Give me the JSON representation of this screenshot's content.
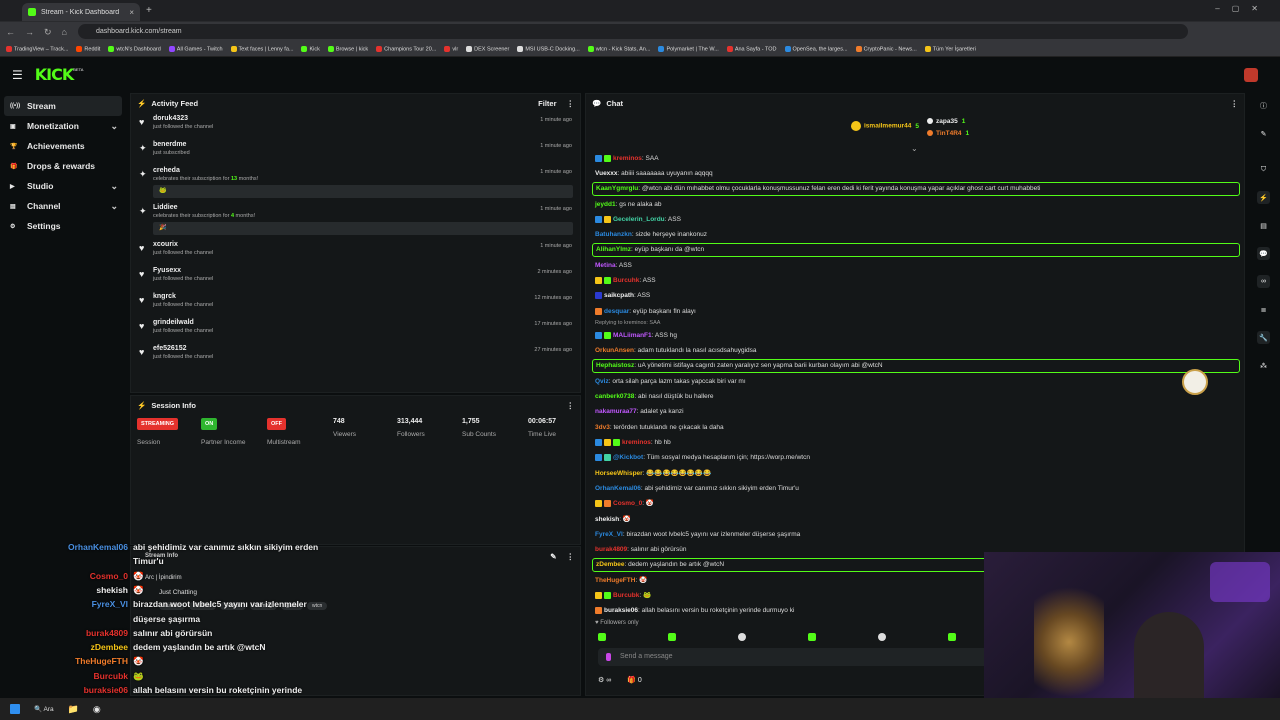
{
  "browser": {
    "tab_title": "Stream - Kick Dashboard",
    "url": "dashboard.kick.com/stream",
    "bookmarks": [
      "TradingView – Track...",
      "Reddit",
      "wtcN's Dashboard",
      "All Games - Twitch",
      "Text faces | Lenny fa...",
      "Kick",
      "Browse | kick",
      "Champions Tour 20...",
      "vlr",
      "DEX Screener",
      "MSI USB-C Docking...",
      "wtcn - Kick Stats, An...",
      "Polymarket | The W...",
      "Ana Sayfa - TOD",
      "OpenSea, the larges...",
      "CryptoPanic - News...",
      "Tüm Yer İşaretleri"
    ]
  },
  "header": {
    "logo": "KICK",
    "logo_tag": "BETA"
  },
  "sidebar": {
    "items": [
      {
        "label": "Stream",
        "icon": "stream-icon",
        "active": true
      },
      {
        "label": "Monetization",
        "icon": "dollar-icon",
        "chevron": true
      },
      {
        "label": "Achievements",
        "icon": "trophy-icon"
      },
      {
        "label": "Drops & rewards",
        "icon": "gift-icon"
      },
      {
        "label": "Studio",
        "icon": "studio-icon",
        "chevron": true
      },
      {
        "label": "Channel",
        "icon": "channel-icon",
        "chevron": true
      },
      {
        "label": "Settings",
        "icon": "gear-icon"
      }
    ]
  },
  "activity": {
    "title": "Activity Feed",
    "filter": "Filter",
    "items": [
      {
        "name": "doruk4323",
        "sub": "just followed the channel",
        "time": "1 minute ago",
        "icon": "heart-icon"
      },
      {
        "name": "benerdme",
        "sub": "just subscribed",
        "time": "1 minute ago",
        "icon": "star-icon"
      },
      {
        "name": "creheda",
        "sub_pre": "celebrates their subscription for ",
        "months": "13",
        "sub_post": " months!",
        "time": "1 minute ago",
        "icon": "star-icon",
        "msg": "🐸"
      },
      {
        "name": "Liddiee",
        "sub_pre": "celebrates their subscription for ",
        "months": "4",
        "sub_post": " months!",
        "time": "1 minute ago",
        "icon": "star-icon",
        "msg": "🎉"
      },
      {
        "name": "xcourix",
        "sub": "just followed the channel",
        "time": "1 minute ago",
        "icon": "heart-icon"
      },
      {
        "name": "Fyusexx",
        "sub": "just followed the channel",
        "time": "2 minutes ago",
        "icon": "heart-icon"
      },
      {
        "name": "kngrck",
        "sub": "just followed the channel",
        "time": "12 minutes ago",
        "icon": "heart-icon"
      },
      {
        "name": "grindeilwald",
        "sub": "just followed the channel",
        "time": "17 minutes ago",
        "icon": "heart-icon"
      },
      {
        "name": "efe526152",
        "sub": "just followed the channel",
        "time": "27 minutes ago",
        "icon": "heart-icon"
      }
    ]
  },
  "session": {
    "title": "Session Info",
    "cells": [
      {
        "badge": "STREAMING",
        "badge_color": "#e5322d",
        "label": "Session"
      },
      {
        "badge": "ON",
        "badge_color": "#2fb52f",
        "label": "Partner Income"
      },
      {
        "badge": "OFF",
        "badge_color": "#e5322d",
        "label": "Multistream"
      },
      {
        "value": "748",
        "label": "Viewers"
      },
      {
        "value": "313,444",
        "label": "Followers"
      },
      {
        "value": "1,755",
        "label": "Sub Counts"
      },
      {
        "value": "00:06:57",
        "label": "Time Live"
      }
    ]
  },
  "stream_info": {
    "title": "Stream Info",
    "title_text": "Arc | İpindirim",
    "category": "Just Chatting",
    "tags": [
      "Turkish",
      "Ranked",
      "Turkce",
      "Gaming",
      "guzel",
      "wtcn"
    ]
  },
  "chat": {
    "title": "Chat",
    "gifters": [
      {
        "name": "ismailmemur44",
        "count": "5",
        "color": "#f5c518"
      },
      {
        "name": "zapa35",
        "count": "1",
        "color": "#eeeeee"
      },
      {
        "name": "TinT4R4",
        "count": "1",
        "color": "#f07c2b"
      }
    ],
    "messages": [
      {
        "user": "kreminos",
        "color": "#e5322d",
        "text": "SAA",
        "badges": [
          "#2b8ae0",
          "#53fc18"
        ]
      },
      {
        "user": "Vuexxx",
        "color": "#eeeeee",
        "text": "abiiii saaaaaaa uyuyanın aqqqq"
      },
      {
        "user": "KaanYgmrglu",
        "color": "#53fc18",
        "text": "@wtcn abi dün mıhabbet olmu çocuklarla konuşmussunuz felan eren dedi ki ferit yayında konuşma yapar açıklar ghost cart curt muhabbeti",
        "highlight": true
      },
      {
        "user": "jeydd1",
        "color": "#53fc18",
        "text": "gs ne alaka ab"
      },
      {
        "user": "Gecelerin_Lordu",
        "color": "#42d3a5",
        "text": "ASS",
        "badges": [
          "#2b8ae0",
          "#f5c518"
        ]
      },
      {
        "user": "Batuhanzkn",
        "color": "#2b8ae0",
        "text": "sizde herşeye inankonuz"
      },
      {
        "user": "AlihanYlmz",
        "color": "#53fc18",
        "text": "eyüp başkanı da @wtcn",
        "highlight": true
      },
      {
        "user": "Metina",
        "color": "#c158ff",
        "text": "ASS"
      },
      {
        "user": "Burcuhk",
        "color": "#e5322d",
        "text": "ASS",
        "badges": [
          "#f5c518",
          "#53fc18"
        ]
      },
      {
        "user": "saikcpath",
        "color": "#eeeeee",
        "text": "ASS",
        "badges": [
          "#2b3ad0"
        ]
      },
      {
        "user": "desquar",
        "color": "#2b8ae0",
        "text": "eyüp başkanı fln alayı",
        "badges": [
          "#f07c2b"
        ]
      },
      {
        "reply": "Replying to kreminos: SAA"
      },
      {
        "user": "MALiimanF1",
        "color": "#c158ff",
        "text": "ASS hg",
        "badges": [
          "#2b8ae0",
          "#53fc18"
        ]
      },
      {
        "user": "OrkunAnsen",
        "color": "#f07c2b",
        "text": "adam tutuklandı la nasıl acısdsahuygidsa"
      },
      {
        "user": "Hephaistosz",
        "color": "#53fc18",
        "text": "uA yönetimi istifaya cagırdı zaten yaralıyız sen yapma barii kurban olayım abi @wtcN",
        "highlight": true
      },
      {
        "user": "Qviz",
        "color": "#2b8ae0",
        "text": "orta silah parça lazm takas yapccak biri var mı"
      },
      {
        "user": "canberk0738",
        "color": "#53fc18",
        "text": "abi nasıl düştük bu hallere"
      },
      {
        "user": "nakamuraa77",
        "color": "#c158ff",
        "text": "adalet ya kanzi"
      },
      {
        "user": "3dv3",
        "color": "#f07c2b",
        "text": "terörden tutuklandı ne çıkacak la daha"
      },
      {
        "user": "kreminos",
        "color": "#e5322d",
        "text": "hb hb",
        "badges": [
          "#2b8ae0",
          "#f5c518",
          "#53fc18"
        ]
      },
      {
        "user": "@Kickbot",
        "color": "#2b8ae0",
        "text": "Tüm sosyal medya hesaplarım için; https://worp.me/wtcn",
        "badges": [
          "#2b8ae0",
          "#42d3a5"
        ]
      },
      {
        "user": "HorseeWhisper",
        "color": "#f5c518",
        "text": "😂😂😂😂😂😂😂😂"
      },
      {
        "user": "OrhanKemal06",
        "color": "#2b8ae0",
        "text": "abi şehidimiz var canımız sıkkın sikiyim erden Timur'u"
      },
      {
        "user": "Cosmo_0",
        "color": "#e5322d",
        "text": "🤡",
        "badges": [
          "#f5c518",
          "#f07c2b"
        ]
      },
      {
        "user": "shekish",
        "color": "#eeeeee",
        "text": "🤡"
      },
      {
        "user": "FyreX_Vl",
        "color": "#2b8ae0",
        "text": "birazdan woot lvbelc5 yayını var izlenmeler düşerse şaşırma"
      },
      {
        "user": "burak4809",
        "color": "#e5322d",
        "text": "salınır abi görürsün"
      },
      {
        "user": "zDembee",
        "color": "#f5c518",
        "text": "dedem yaşlandın be artık @wtcN",
        "highlight": true
      },
      {
        "user": "TheHugeFTH",
        "color": "#f07c2b",
        "text": "🤡"
      },
      {
        "user": "Burcubk",
        "color": "#e5322d",
        "text": "🐸",
        "badges": [
          "#f5c518",
          "#53fc18"
        ]
      },
      {
        "user": "buraksie06",
        "color": "#eeeeee",
        "text": "allah belasını versin bu roketçinin yerinde durmuyo ki",
        "badges": [
          "#f07c2b"
        ]
      }
    ],
    "followers_only": "Followers only",
    "input_placeholder": "Send a message",
    "bottom_left": "∞",
    "bottom_count": "0"
  },
  "overlay": {
    "lines": [
      {
        "user": "OrhanKemal06",
        "color": "#4a90e2",
        "text": "abi şehidimiz var canımız sıkkın sikiyim erden"
      },
      {
        "user": "",
        "color": "#eeeeee",
        "text": "Timur'u"
      },
      {
        "user": "Cosmo_0",
        "color": "#e5322d",
        "text": "🤡"
      },
      {
        "user": "shekish",
        "color": "#eeeeee",
        "text": "🤡"
      },
      {
        "user": "FyreX_Vl",
        "color": "#4a90e2",
        "text": "birazdan woot lvbelc5 yayını var izlenmeler"
      },
      {
        "user": "",
        "color": "#eeeeee",
        "text": "düşerse şaşırma"
      },
      {
        "user": "burak4809",
        "color": "#e5322d",
        "text": "salınır abi görürsün"
      },
      {
        "user": "zDembee",
        "color": "#f5c518",
        "text": "dedem yaşlandın be artık @wtcN"
      },
      {
        "user": "TheHugeFTH",
        "color": "#f07c2b",
        "text": "🤡"
      },
      {
        "user": "Burcubk",
        "color": "#e5322d",
        "text": "🐸"
      },
      {
        "user": "buraksie06",
        "color": "#e5322d",
        "text": "allah belasını versin bu roketçinin yerinde"
      },
      {
        "user": "",
        "color": "#eeeeee",
        "text": "durmuyo ki"
      }
    ]
  },
  "taskbar": {
    "search": "Ara"
  }
}
